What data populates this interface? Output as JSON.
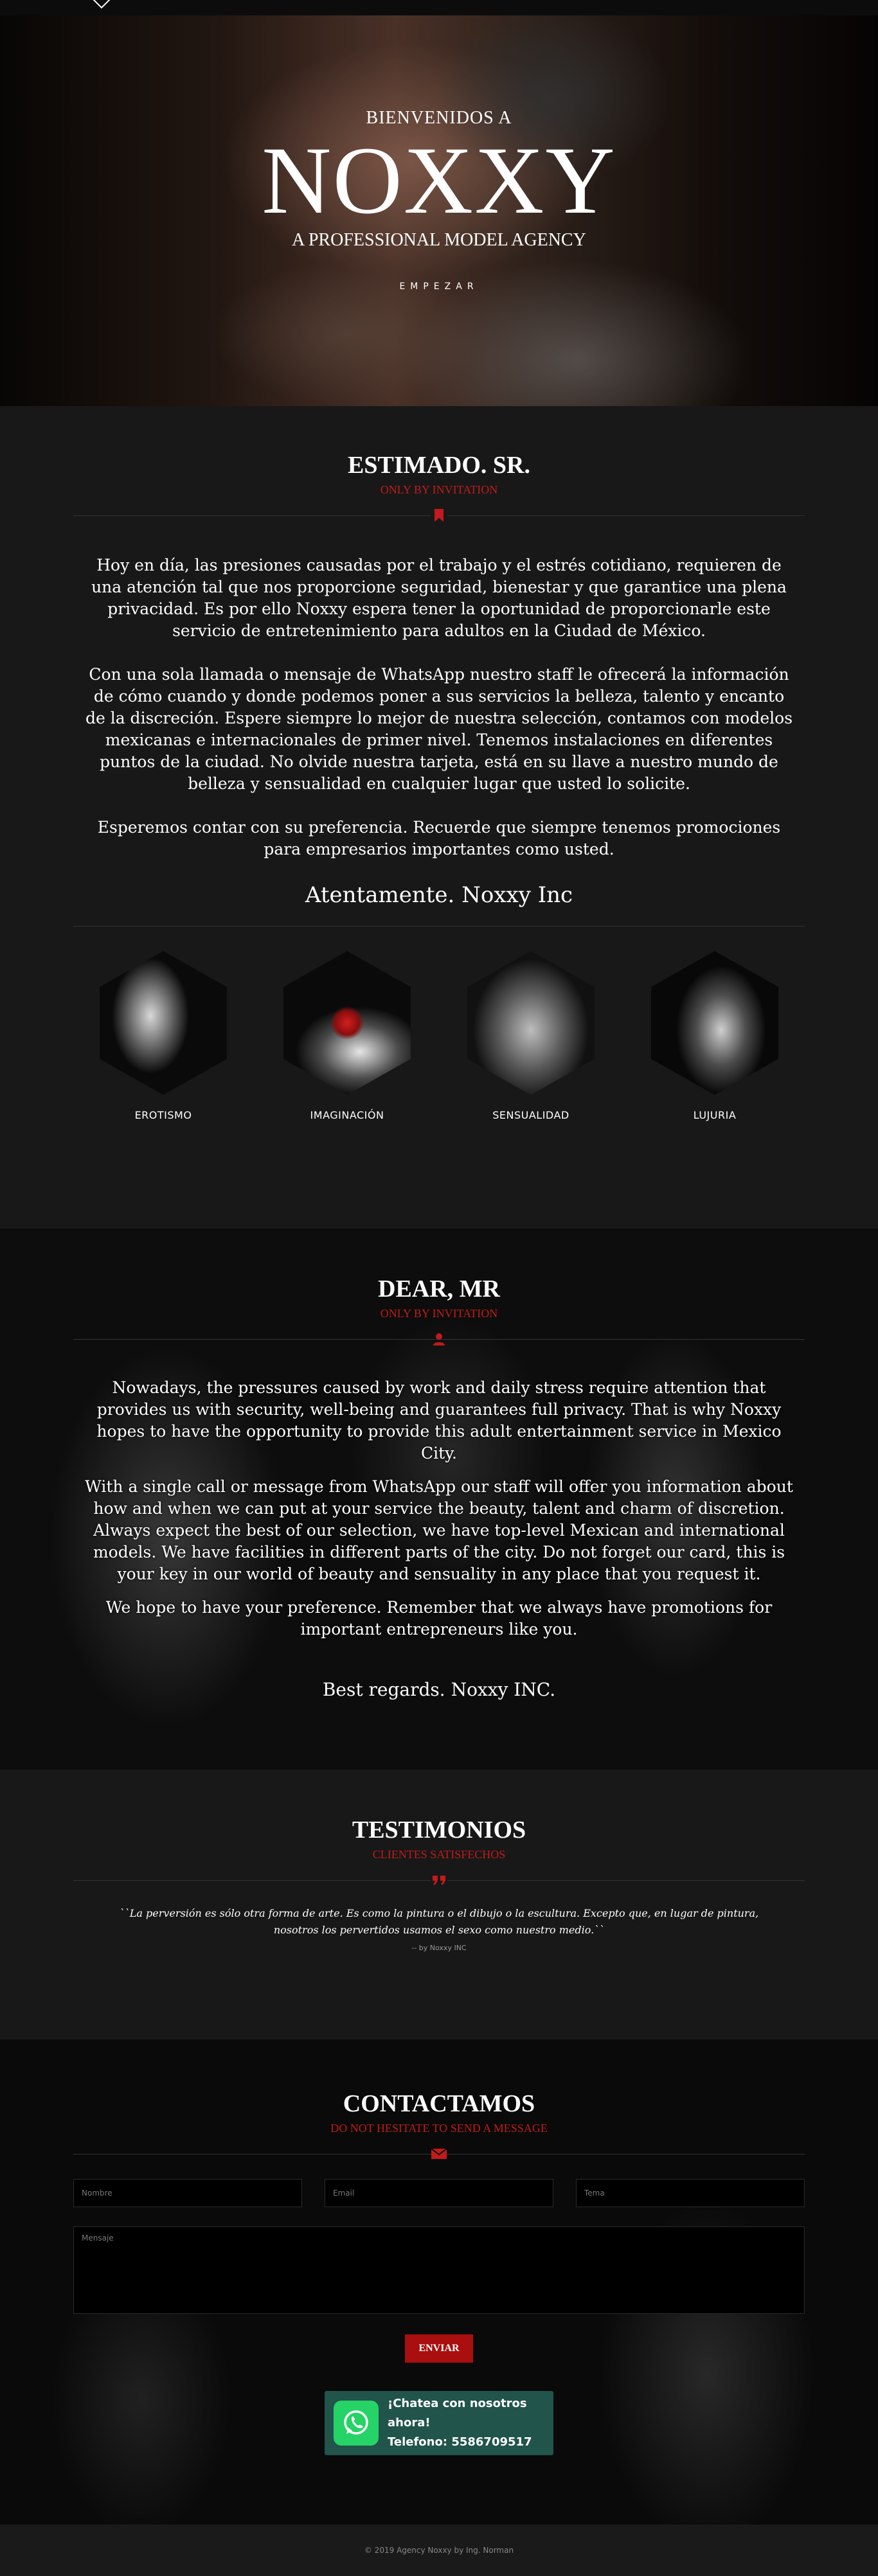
{
  "hero": {
    "welcome": "BIENVENIDOS A",
    "brand": "NOXXY",
    "tagline": "A PROFESSIONAL MODEL AGENCY",
    "cta": "EMPEZAR"
  },
  "spanish": {
    "title": "ESTIMADO. SR.",
    "subtitle": "ONLY BY INVITATION",
    "icon": "bookmark-icon",
    "paragraphs": [
      "Hoy en día, las presiones causadas por el trabajo y el estrés cotidiano, requieren de una atención tal que nos proporcione seguridad, bienestar y que garantice una plena privacidad. Es por ello Noxxy espera tener la oportunidad de proporcionarle este servicio de entretenimiento para adultos en la Ciudad de México.",
      "Con una sola llamada o mensaje de WhatsApp nuestro staff le ofrecerá la información de cómo cuando y donde podemos poner a sus servicios la belleza, talento y encanto de la discreción. Espere siempre lo mejor de nuestra selección, contamos con modelos mexicanas e internacionales de primer nivel. Tenemos instalaciones en diferentes puntos de la ciudad. No olvide nuestra tarjeta, está en su llave a nuestro mundo de belleza y sensualidad en cualquier lugar que usted lo solicite.",
      "Esperemos contar con su preferencia. Recuerde que siempre tenemos promociones para empresarios importantes como usted."
    ],
    "signature": "Atentamente. Noxxy Inc",
    "features": [
      {
        "label": "EROTISMO"
      },
      {
        "label": "IMAGINACIÓN"
      },
      {
        "label": "SENSUALIDAD"
      },
      {
        "label": "LUJURIA"
      }
    ]
  },
  "english": {
    "title": "DEAR, MR",
    "subtitle": "ONLY BY INVITATION",
    "icon": "user-icon",
    "paragraphs": [
      "Nowadays, the pressures caused by work and daily stress require attention that provides us with security, well-being and guarantees full privacy. That is why Noxxy hopes to have the opportunity to provide this adult entertainment service in Mexico City.",
      "With a single call or message from WhatsApp our staff will offer you information about how and when we can put at your service the beauty, talent and charm of discretion. Always expect the best of our selection, we have top-level Mexican and international models. We have facilities in different parts of the city. Do not forget our card, this is your key in our world of beauty and sensuality in any place that you request it.",
      "We hope to have your preference. Remember that we always have promotions for important entrepreneurs like you."
    ],
    "signature": "Best regards. Noxxy INC."
  },
  "testimonials": {
    "title": "TESTIMONIOS",
    "subtitle": "CLIENTES SATISFECHOS",
    "icon": "quote-icon",
    "quote": "``La perversión es sólo otra forma de arte. Es como la pintura o el dibujo o la escultura. Excepto que, en lugar de pintura, nosotros los pervertidos usamos el sexo como nuestro medio.``",
    "author": "-- by Noxxy INC"
  },
  "contact": {
    "title": "CONTACTAMOS",
    "subtitle": "DO NOT HESITATE TO SEND A MESSAGE",
    "icon": "envelope-icon",
    "name_placeholder": "Nombre",
    "email_placeholder": "Email",
    "subject_placeholder": "Tema",
    "message_placeholder": "Mensaje",
    "send_label": "ENVIAR",
    "whatsapp_line1": "¡Chatea con nosotros ahora!",
    "whatsapp_line2": "Telefono: 5586709517"
  },
  "footer": {
    "text": "© 2019 Agency Noxxy by Ing. Norman"
  },
  "colors": {
    "accent_red": "#c11b1b",
    "button_red": "#a90f0f",
    "whatsapp_green": "#25d366",
    "whatsapp_box": "#21544b"
  }
}
